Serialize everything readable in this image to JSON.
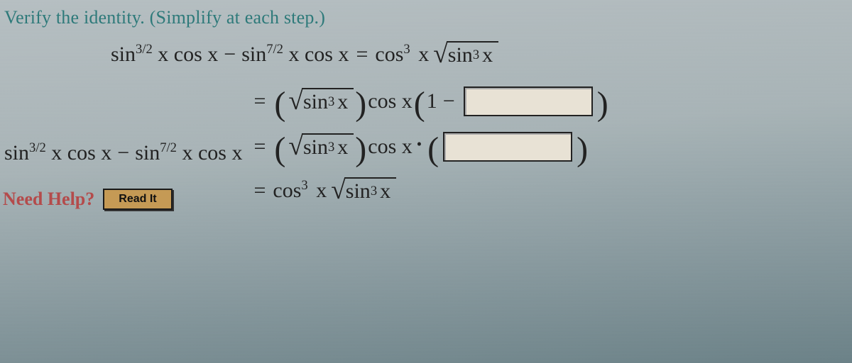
{
  "prompt": "Verify the identity. (Simplify at each step.)",
  "identity": {
    "lhs_a": "sin",
    "lhs_a_exp": "3/2",
    "lhs_b": "x cos x",
    "minus": "−",
    "lhs_c": "sin",
    "lhs_c_exp": "7/2",
    "lhs_d": "x cos x",
    "eq": "=",
    "rhs_a": "cos",
    "rhs_a_exp": "3",
    "rhs_b": "x",
    "sqrt_a": "sin",
    "sqrt_a_exp": "3",
    "sqrt_b": "x"
  },
  "work": {
    "lhs_a": "sin",
    "lhs_a_exp": "3/2",
    "lhs_b": "x cos x",
    "minus": "−",
    "lhs_c": "sin",
    "lhs_c_exp": "7/2",
    "lhs_d": "x cos x",
    "eq": "=",
    "step1": {
      "sqrt_a": "sin",
      "sqrt_a_exp": "3",
      "sqrt_b": "x",
      "after_sqrt": "cos x",
      "tail_pre": "1",
      "tail_minus": "−"
    },
    "step2": {
      "sqrt_a": "sin",
      "sqrt_a_exp": "3",
      "sqrt_b": "x",
      "after_sqrt": "cos x"
    },
    "step3": {
      "a": "cos",
      "a_exp": "3",
      "b": "x",
      "sqrt_a": "sin",
      "sqrt_a_exp": "3",
      "sqrt_b": "x"
    }
  },
  "help": {
    "label": "Need Help?",
    "read": "Read It"
  }
}
